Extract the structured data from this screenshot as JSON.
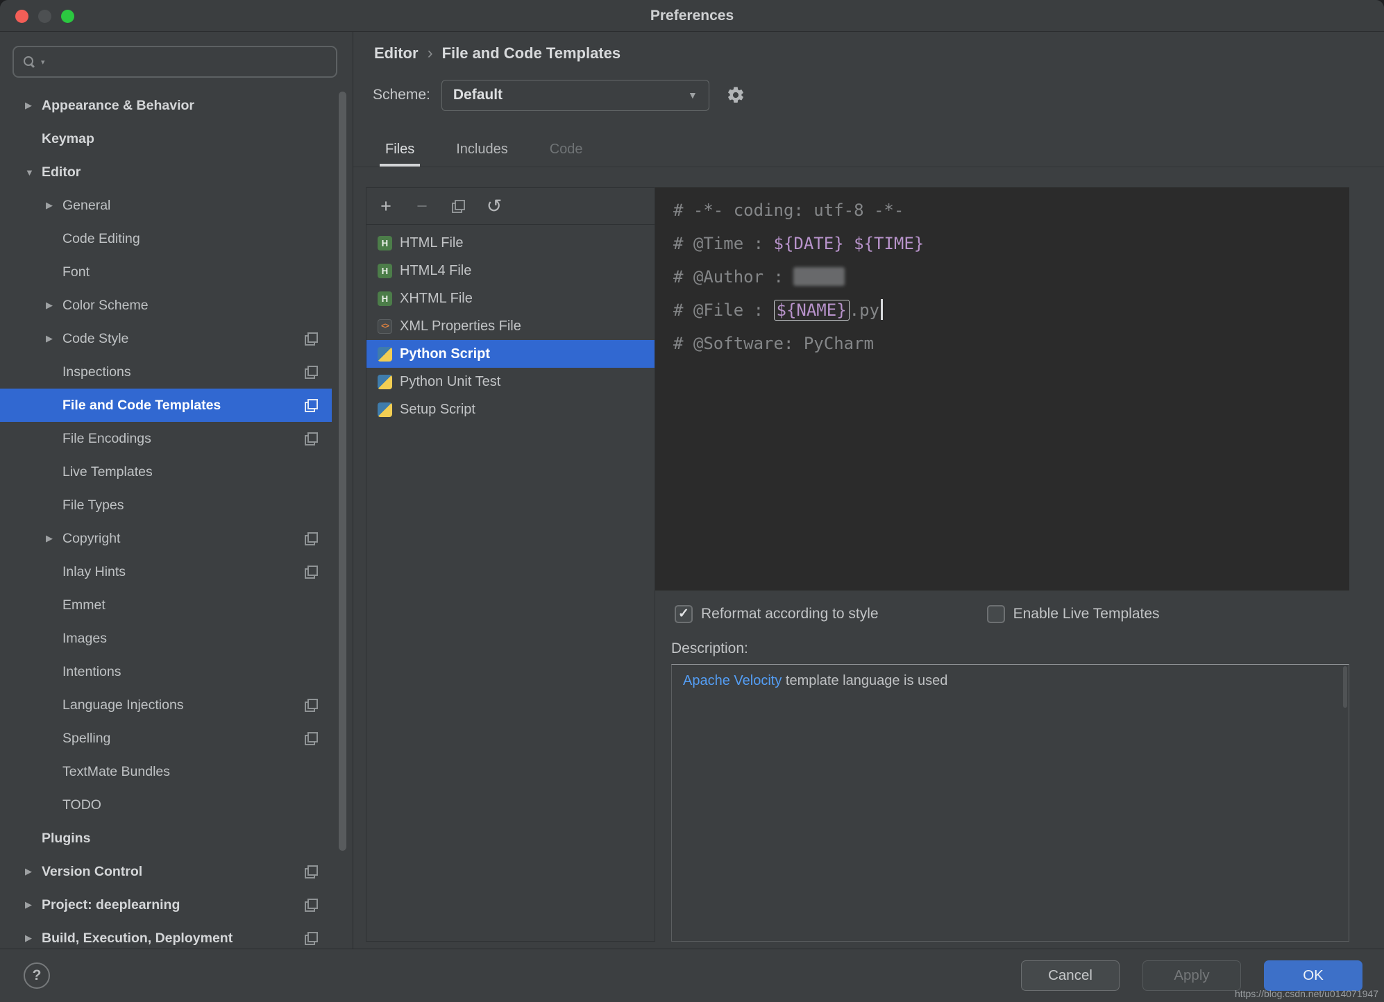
{
  "window": {
    "title": "Preferences"
  },
  "sidebar": {
    "search": {
      "placeholder": ""
    },
    "items": [
      {
        "label": "Appearance & Behavior",
        "level": 0,
        "arrow": "right",
        "bold": true,
        "selected": false,
        "badge": false
      },
      {
        "label": "Keymap",
        "level": 0,
        "arrow": null,
        "bold": true,
        "selected": false,
        "badge": false
      },
      {
        "label": "Editor",
        "level": 0,
        "arrow": "down",
        "bold": true,
        "selected": false,
        "badge": false
      },
      {
        "label": "General",
        "level": 1,
        "arrow": "right",
        "bold": false,
        "selected": false,
        "badge": false
      },
      {
        "label": "Code Editing",
        "level": 1,
        "arrow": null,
        "bold": false,
        "selected": false,
        "badge": false
      },
      {
        "label": "Font",
        "level": 1,
        "arrow": null,
        "bold": false,
        "selected": false,
        "badge": false
      },
      {
        "label": "Color Scheme",
        "level": 1,
        "arrow": "right",
        "bold": false,
        "selected": false,
        "badge": false
      },
      {
        "label": "Code Style",
        "level": 1,
        "arrow": "right",
        "bold": false,
        "selected": false,
        "badge": true
      },
      {
        "label": "Inspections",
        "level": 1,
        "arrow": null,
        "bold": false,
        "selected": false,
        "badge": true
      },
      {
        "label": "File and Code Templates",
        "level": 1,
        "arrow": null,
        "bold": false,
        "selected": true,
        "badge": true
      },
      {
        "label": "File Encodings",
        "level": 1,
        "arrow": null,
        "bold": false,
        "selected": false,
        "badge": true
      },
      {
        "label": "Live Templates",
        "level": 1,
        "arrow": null,
        "bold": false,
        "selected": false,
        "badge": false
      },
      {
        "label": "File Types",
        "level": 1,
        "arrow": null,
        "bold": false,
        "selected": false,
        "badge": false
      },
      {
        "label": "Copyright",
        "level": 1,
        "arrow": "right",
        "bold": false,
        "selected": false,
        "badge": true
      },
      {
        "label": "Inlay Hints",
        "level": 1,
        "arrow": null,
        "bold": false,
        "selected": false,
        "badge": true
      },
      {
        "label": "Emmet",
        "level": 1,
        "arrow": null,
        "bold": false,
        "selected": false,
        "badge": false
      },
      {
        "label": "Images",
        "level": 1,
        "arrow": null,
        "bold": false,
        "selected": false,
        "badge": false
      },
      {
        "label": "Intentions",
        "level": 1,
        "arrow": null,
        "bold": false,
        "selected": false,
        "badge": false
      },
      {
        "label": "Language Injections",
        "level": 1,
        "arrow": null,
        "bold": false,
        "selected": false,
        "badge": true
      },
      {
        "label": "Spelling",
        "level": 1,
        "arrow": null,
        "bold": false,
        "selected": false,
        "badge": true
      },
      {
        "label": "TextMate Bundles",
        "level": 1,
        "arrow": null,
        "bold": false,
        "selected": false,
        "badge": false
      },
      {
        "label": "TODO",
        "level": 1,
        "arrow": null,
        "bold": false,
        "selected": false,
        "badge": false
      },
      {
        "label": "Plugins",
        "level": 0,
        "arrow": null,
        "bold": true,
        "selected": false,
        "badge": false
      },
      {
        "label": "Version Control",
        "level": 0,
        "arrow": "right",
        "bold": true,
        "selected": false,
        "badge": true
      },
      {
        "label": "Project: deeplearning",
        "level": 0,
        "arrow": "right",
        "bold": true,
        "selected": false,
        "badge": true
      },
      {
        "label": "Build, Execution, Deployment",
        "level": 0,
        "arrow": "right",
        "bold": true,
        "selected": false,
        "badge": true
      }
    ]
  },
  "content": {
    "breadcrumb": {
      "parent": "Editor",
      "separator": "›",
      "current": "File and Code Templates"
    },
    "scheme": {
      "label": "Scheme:",
      "value": "Default"
    },
    "tabs": [
      {
        "label": "Files",
        "state": "active"
      },
      {
        "label": "Includes",
        "state": "normal"
      },
      {
        "label": "Code",
        "state": "disabled"
      }
    ],
    "toolbar": [
      {
        "name": "add",
        "glyph": "+",
        "disabled": false
      },
      {
        "name": "remove",
        "glyph": "−",
        "disabled": true
      },
      {
        "name": "copy",
        "glyph": "",
        "disabled": false
      },
      {
        "name": "revert",
        "glyph": "↺",
        "disabled": false
      }
    ],
    "templates": [
      {
        "label": "HTML File",
        "icon": "html",
        "selected": false
      },
      {
        "label": "HTML4 File",
        "icon": "html",
        "selected": false
      },
      {
        "label": "XHTML File",
        "icon": "html",
        "selected": false
      },
      {
        "label": "XML Properties File",
        "icon": "xml",
        "selected": false
      },
      {
        "label": "Python Script",
        "icon": "python",
        "selected": true
      },
      {
        "label": "Python Unit Test",
        "icon": "python",
        "selected": false
      },
      {
        "label": "Setup Script",
        "icon": "python",
        "selected": false
      }
    ],
    "editor_lines": [
      {
        "tokens": [
          {
            "text": "# -*- coding: utf-8 -*-",
            "style": "comment"
          }
        ]
      },
      {
        "tokens": [
          {
            "text": "# @Time : ",
            "style": "comment"
          },
          {
            "text": "${DATE}",
            "style": "variable"
          },
          {
            "text": " ",
            "style": "comment"
          },
          {
            "text": "${TIME}",
            "style": "variable"
          }
        ]
      },
      {
        "tokens": [
          {
            "text": "# @Author : ",
            "style": "comment"
          },
          {
            "text": "",
            "style": "redacted"
          }
        ]
      },
      {
        "tokens": [
          {
            "text": "# @File : ",
            "style": "comment"
          },
          {
            "text": "${NAME}",
            "style": "variable-boxed"
          },
          {
            "text": ".py",
            "style": "comment"
          },
          {
            "text": "",
            "style": "caret"
          }
        ]
      },
      {
        "tokens": [
          {
            "text": "# @Software: PyCharm",
            "style": "comment"
          }
        ]
      }
    ],
    "options": [
      {
        "label": "Reformat according to style",
        "checked": true
      },
      {
        "label": "Enable Live Templates",
        "checked": false
      }
    ],
    "description": {
      "label": "Description:",
      "link": "Apache Velocity",
      "text": " template language is used"
    }
  },
  "footer": {
    "help": "?",
    "cancel": "Cancel",
    "apply": "Apply",
    "ok": "OK",
    "watermark": "https://blog.csdn.net/u014071947"
  },
  "colors": {
    "selection_blue": "#3168d1",
    "editor_background": "#2b2b2b",
    "dialog_background": "#3c3f41",
    "link_blue": "#549ef5",
    "ok_button_blue": "#3d70c8",
    "comment_gray": "#848688",
    "variable_purple": "#b893cb"
  }
}
